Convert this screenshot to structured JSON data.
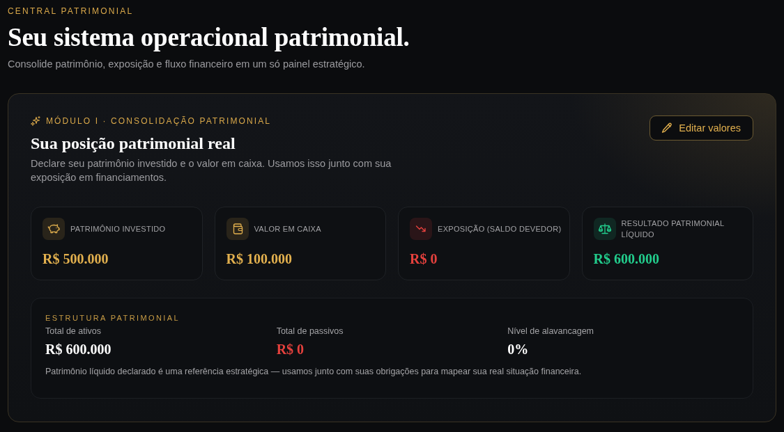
{
  "header": {
    "eyebrow": "CENTRAL PATRIMONIAL",
    "title": "Seu sistema operacional patrimonial.",
    "subtitle": "Consolide patrimônio, exposição e fluxo financeiro em um só painel estratégico."
  },
  "module": {
    "eyebrow": "MÓDULO I · CONSOLIDAÇÃO PATRIMONIAL",
    "title": "Sua posição patrimonial real",
    "description": "Declare seu patrimônio investido e o valor em caixa. Usamos isso junto com sua exposição em financiamentos.",
    "edit_button": "Editar valores"
  },
  "metrics": [
    {
      "kind": "piggy-bank",
      "label": "PATRIMÔNIO INVESTIDO",
      "value": "R$ 500.000",
      "color": "#e2b04e"
    },
    {
      "kind": "wallet",
      "label": "VALOR EM CAIXA",
      "value": "R$ 100.000",
      "color": "#e2b04e"
    },
    {
      "kind": "trend-down",
      "label": "EXPOSIÇÃO (SALDO DEVEDOR)",
      "value": "R$ 0",
      "color": "#e5413d"
    },
    {
      "kind": "scale",
      "label": "RESULTADO PATRIMONIAL LÍQUIDO",
      "value": "R$ 600.000",
      "color": "#22cc8c"
    }
  ],
  "structure": {
    "title": "ESTRUTURA PATRIMONIAL",
    "items": [
      {
        "label": "Total de ativos",
        "value": "R$ 600.000",
        "color": "#ffffff"
      },
      {
        "label": "Total de passivos",
        "value": "R$ 0",
        "color": "#e5413d"
      },
      {
        "label": "Nível de alavancagem",
        "value": "0%",
        "color": "#ffffff"
      }
    ],
    "note": "Patrimônio líquido declarado é uma referência estratégica — usamos junto com suas obrigações para mapear sua real situação financeira."
  }
}
